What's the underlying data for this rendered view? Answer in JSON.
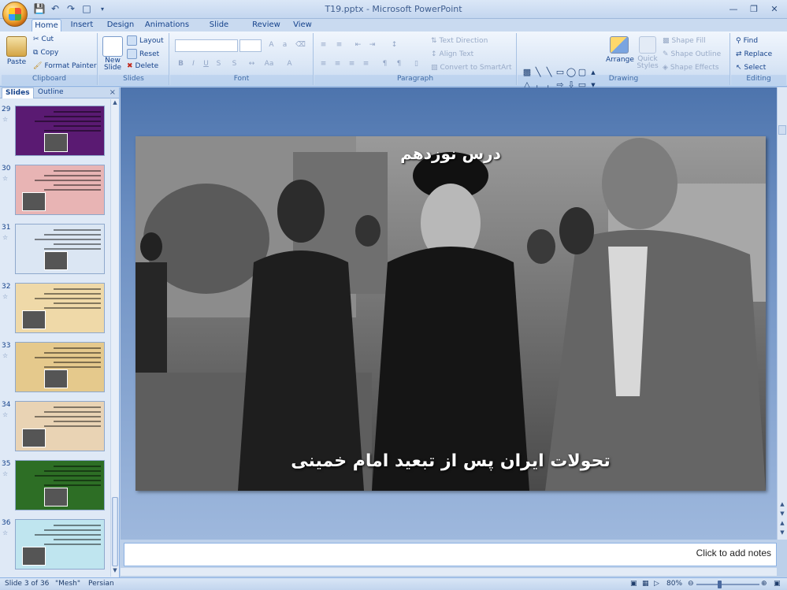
{
  "window": {
    "title": "T19.pptx - Microsoft PowerPoint"
  },
  "tabs": [
    "Home",
    "Insert",
    "Design",
    "Animations",
    "Slide Show",
    "Review",
    "View"
  ],
  "ribbon": {
    "clipboard": {
      "label": "Clipboard",
      "paste": "Paste",
      "cut": "Cut",
      "copy": "Copy",
      "format_painter": "Format Painter"
    },
    "slides": {
      "label": "Slides",
      "new_slide": "New",
      "new_slide2": "Slide",
      "layout": "Layout",
      "reset": "Reset",
      "delete": "Delete"
    },
    "font": {
      "label": "Font"
    },
    "paragraph": {
      "label": "Paragraph",
      "text_direction": "Text Direction",
      "align_text": "Align Text",
      "convert_smartart": "Convert to SmartArt"
    },
    "drawing": {
      "label": "Drawing",
      "arrange": "Arrange",
      "quick_styles": "Quick",
      "quick_styles2": "Styles",
      "shape_fill": "Shape Fill",
      "shape_outline": "Shape Outline",
      "shape_effects": "Shape Effects"
    },
    "editing": {
      "label": "Editing",
      "find": "Find",
      "replace": "Replace",
      "select": "Select"
    }
  },
  "left_panel": {
    "tabs": [
      "Slides",
      "Outline"
    ],
    "thumbnails": [
      {
        "num": "29",
        "bg": "#5a1a72"
      },
      {
        "num": "30",
        "bg": "#e8b4b4"
      },
      {
        "num": "31",
        "bg": "#dbe6f3"
      },
      {
        "num": "32",
        "bg": "#efd9a8"
      },
      {
        "num": "33",
        "bg": "#e5c98c"
      },
      {
        "num": "34",
        "bg": "#e9d3b4"
      },
      {
        "num": "35",
        "bg": "#2d6e25"
      },
      {
        "num": "36",
        "bg": "#bfe5ef"
      }
    ]
  },
  "slide": {
    "title": "درس نوزدهم",
    "subtitle": "تحولات ایران پس از تبعید امام خمینی"
  },
  "notes": {
    "placeholder": "Click to add notes"
  },
  "status": {
    "slide_info": "Slide 3 of 36",
    "theme": "\"Mesh\"",
    "language": "Persian",
    "zoom": "80%"
  }
}
